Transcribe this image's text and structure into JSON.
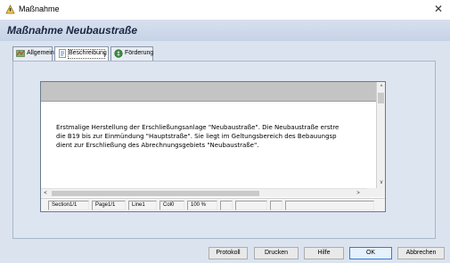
{
  "window": {
    "title": "Maßnahme",
    "close_glyph": "✕"
  },
  "header": {
    "title": "Maßnahme  Neubaustraße"
  },
  "tabs": [
    {
      "label": "Allgemein",
      "icon": "map-icon",
      "active": false
    },
    {
      "label": "Beschreibung",
      "icon": "document-icon",
      "active": true
    },
    {
      "label": "Förderung",
      "icon": "money-bag-icon",
      "active": false
    }
  ],
  "editor": {
    "lines": [
      "Erstmalige Herstellung der Erschließungsanlage \"Neubaustraße\". Die Neubaustraße erstre",
      "die B19 bis zur Einmündung \"Hauptstraße\". Sie liegt im Geltungsbereich des Bebauungsp",
      "dient zur Erschließung des Abrechnungsgebiets \"Neubaustraße\"."
    ],
    "scroll_up": "^",
    "scroll_down": "v",
    "scroll_left": "<",
    "scroll_right": ">"
  },
  "statusbar": {
    "section": "Section1/1",
    "page": "Page1/1",
    "line": "Line1",
    "col": "Col0",
    "zoom": "100 %"
  },
  "buttons": {
    "protokoll": "Protokoll",
    "drucken": "Drucken",
    "hilfe": "Hilfe",
    "ok": "OK",
    "abbrechen": "Abbrechen"
  },
  "colors": {
    "accent": "#3a78d6",
    "client_bg": "#dbe3ef",
    "title_color": "#1b2440"
  }
}
